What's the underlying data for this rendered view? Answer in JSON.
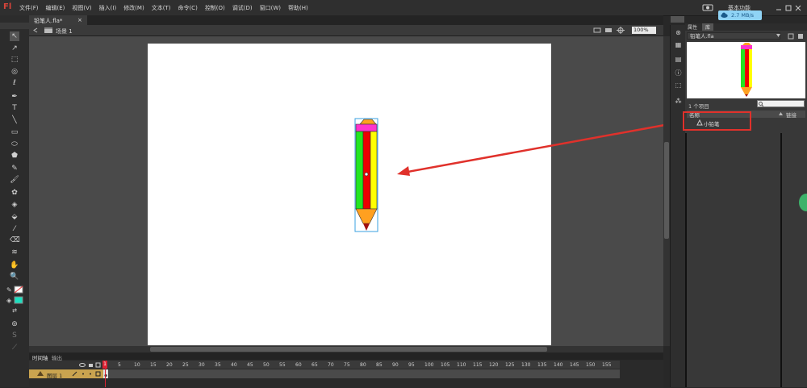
{
  "app": {
    "logo": "Fl",
    "workspace_label": "基本功能"
  },
  "menu": [
    "文件(F)",
    "编辑(E)",
    "视图(V)",
    "插入(I)",
    "修改(M)",
    "文本(T)",
    "命令(C)",
    "控制(O)",
    "调试(D)",
    "窗口(W)",
    "帮助(H)"
  ],
  "network_badge": {
    "speed": "2.7 MB/s",
    "icon": "cloud-icon"
  },
  "document_tab": {
    "title": "铅笔人.fla*",
    "close": "×"
  },
  "edit_bar": {
    "scene_label": "场景 1",
    "zoom": "100%"
  },
  "library": {
    "tabs": [
      "属性",
      "库"
    ],
    "active_tab": "库",
    "document": "铅笔人.fla",
    "item_count": "1 个项目",
    "columns": {
      "name": "名称",
      "linkage": "链接"
    },
    "items": [
      {
        "name": "小铅笔",
        "icon": "graphic-symbol-icon"
      }
    ]
  },
  "timeline": {
    "tabs": [
      "时间轴",
      "输出"
    ],
    "layer_name": "图层 1",
    "current_frame": "1",
    "ticks": [
      "1",
      "5",
      "10",
      "15",
      "20",
      "25",
      "30",
      "35",
      "40",
      "45",
      "50",
      "55",
      "60",
      "65",
      "70",
      "75",
      "80",
      "85",
      "90",
      "95",
      "100",
      "105",
      "110",
      "115",
      "120",
      "125",
      "130",
      "135",
      "140",
      "145",
      "150",
      "155"
    ]
  },
  "colors": {
    "annotation": "#e0312b",
    "pencil_green": "#22e622",
    "pencil_red": "#ee0000",
    "pencil_yellow": "#ffff00",
    "pencil_pink": "#ff33cc",
    "pencil_orange": "#ffa020",
    "layer_highlight": "#c9a34f"
  }
}
